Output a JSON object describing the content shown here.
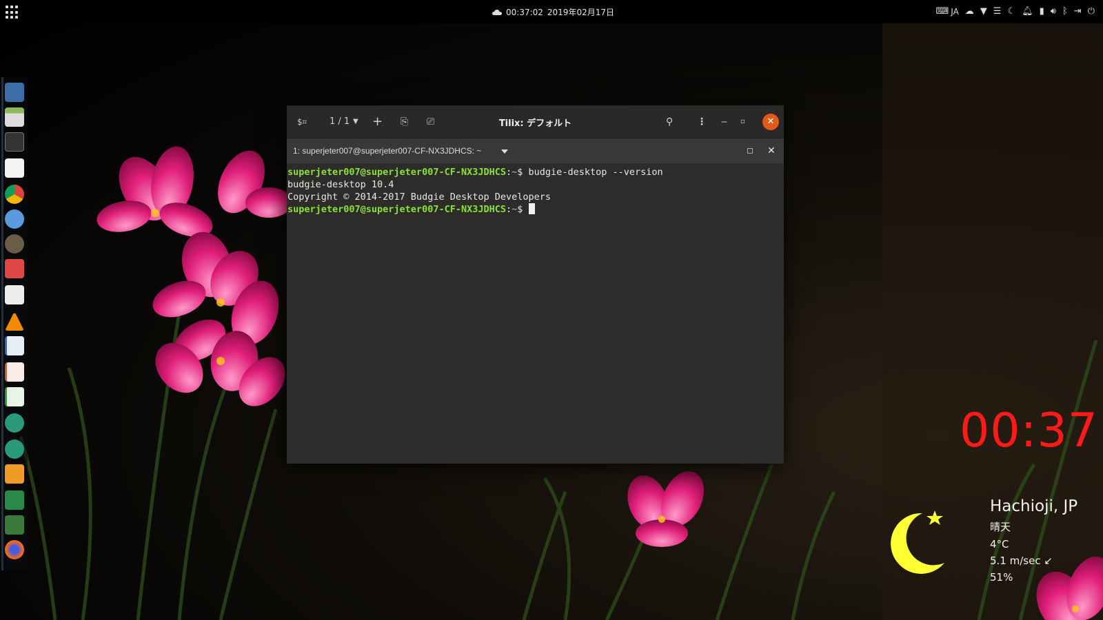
{
  "top_panel": {
    "time": "00:37:02",
    "date": "2019年02月17日",
    "tray_icons": [
      "keyboard-icon",
      "input-method-ja",
      "cloud-toggle-icon",
      "wifi-icon",
      "menu-icon",
      "night-mode-icon",
      "notification-bell-icon",
      "battery-icon",
      "volume-icon",
      "bluetooth-icon",
      "logout-icon",
      "power-icon"
    ],
    "input_method_label": "JA"
  },
  "dock": {
    "items": [
      "screenshot-app",
      "files",
      "terminal-tilix",
      "text-editor",
      "chrome",
      "thunderbird",
      "gimp",
      "photo-viewer",
      "rhythmbox",
      "vlc",
      "libreoffice-writer",
      "libreoffice-impress",
      "libreoffice-calc",
      "settings-tool-1",
      "settings-tool-2",
      "downloader",
      "system-monitor",
      "trash",
      "firefox"
    ]
  },
  "window": {
    "title": "Tilix: デフォルト",
    "session_count": "1 / 1",
    "tab_title": "1: superjeter007@superjeter007-CF-NX3JDHCS: ~"
  },
  "terminal": {
    "prompt_user_host": "superjeter007@superjeter007-CF-NX3JDHCS",
    "prompt_path": "~",
    "prompt_symbol": "$",
    "command": "budgie-desktop --version",
    "output_line_1": "budgie-desktop 10.4",
    "output_line_2": "Copyright © 2014-2017 Budgie Desktop Developers"
  },
  "clock_widget": {
    "time": "00:37"
  },
  "weather_widget": {
    "city": "Hachioji, JP",
    "condition": "晴天",
    "temperature": "4°C",
    "wind": "5.1 m/sec ↙",
    "humidity": "51%"
  },
  "colors": {
    "clock_red": "#ff1a1a",
    "close_button": "#e15a1a",
    "prompt_green": "#8ae234",
    "moon_yellow": "#ffff33"
  }
}
